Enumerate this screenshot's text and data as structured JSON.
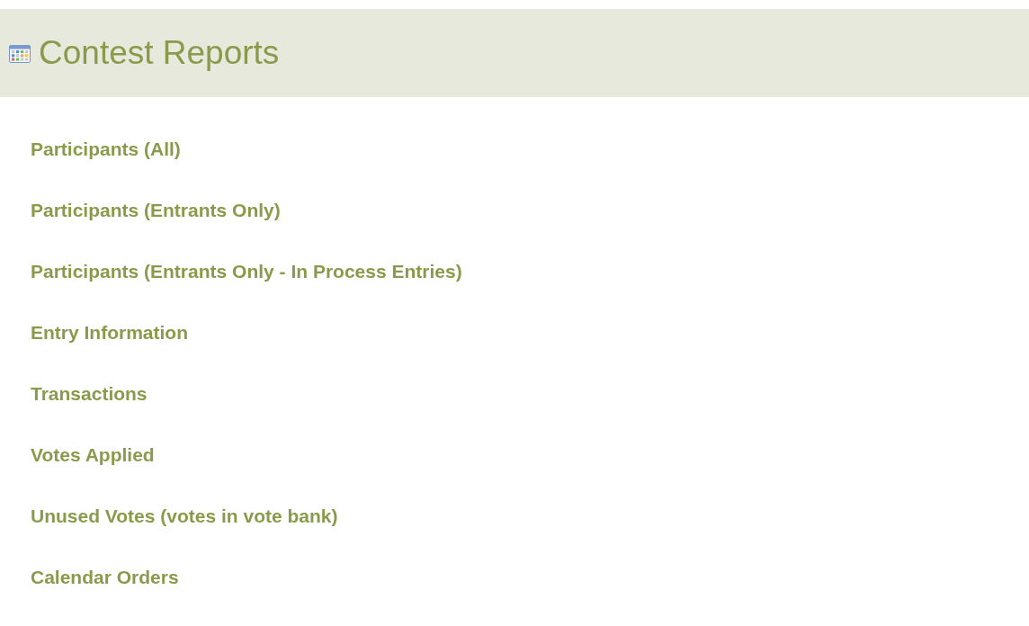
{
  "header": {
    "title": "Contest Reports"
  },
  "links": [
    {
      "label": "Participants (All)"
    },
    {
      "label": "Participants (Entrants Only)"
    },
    {
      "label": "Participants (Entrants Only - In Process Entries)"
    },
    {
      "label": "Entry Information"
    },
    {
      "label": "Transactions"
    },
    {
      "label": "Votes Applied"
    },
    {
      "label": "Unused Votes (votes in vote bank)"
    },
    {
      "label": "Calendar Orders"
    }
  ]
}
